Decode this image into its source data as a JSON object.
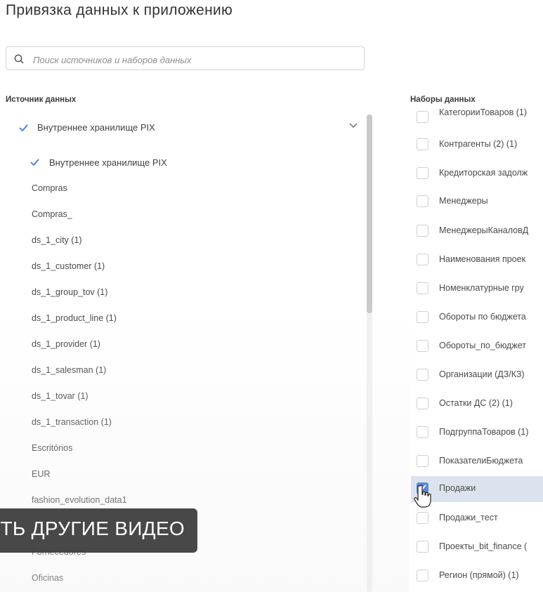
{
  "page": {
    "title": "Привязка данных к приложению"
  },
  "search": {
    "placeholder": "Поиск источников и наборов данных",
    "value": ""
  },
  "sources": {
    "label": "Источник данных",
    "parent": "Внутреннее хранилище PIX",
    "items": [
      {
        "label": "Внутреннее хранилище PIX",
        "selected": true
      },
      {
        "label": "Compras"
      },
      {
        "label": "Compras_"
      },
      {
        "label": "ds_1_city (1)"
      },
      {
        "label": "ds_1_customer (1)"
      },
      {
        "label": "ds_1_group_tov (1)"
      },
      {
        "label": "ds_1_product_line (1)"
      },
      {
        "label": "ds_1_provider (1)"
      },
      {
        "label": "ds_1_salesman (1)"
      },
      {
        "label": "ds_1_tovar (1)"
      },
      {
        "label": "ds_1_transaction (1)"
      },
      {
        "label": "Escritórios"
      },
      {
        "label": "EUR"
      },
      {
        "label": "fashion_evolution_data1"
      },
      {
        "label": ""
      },
      {
        "label": "Fornecedores"
      },
      {
        "label": "Oficinas"
      }
    ]
  },
  "datasets": {
    "label": "Наборы данных",
    "items": [
      {
        "label": "КатегорииТоваров (1)",
        "checked": false
      },
      {
        "label": "Контрагенты (2) (1)",
        "checked": false
      },
      {
        "label": "Кредиторская задолж",
        "checked": false
      },
      {
        "label": "Менеджеры",
        "checked": false
      },
      {
        "label": "МенеджерыКаналовД",
        "checked": false
      },
      {
        "label": "Наименования проек",
        "checked": false
      },
      {
        "label": "Номенклатурные гру",
        "checked": false
      },
      {
        "label": "Обороты по бюджета",
        "checked": false
      },
      {
        "label": "Обороты_по_бюджет",
        "checked": false
      },
      {
        "label": "Организации (ДЗ/КЗ)",
        "checked": false
      },
      {
        "label": "Остатки ДС (2) (1)",
        "checked": false
      },
      {
        "label": "ПодгруппаТоваров (1)",
        "checked": false
      },
      {
        "label": "ПоказателиБюджета",
        "checked": false
      },
      {
        "label": "Продажи",
        "checked": true
      },
      {
        "label": "Продажи_тест",
        "checked": false
      },
      {
        "label": "Проекты_bit_finance (",
        "checked": false
      },
      {
        "label": "Регион (прямой) (1)",
        "checked": false
      }
    ]
  },
  "overlay": {
    "text": "ТЬ ДРУГИЕ ВИДЕО"
  },
  "colors": {
    "accent": "#3b7de0",
    "checked_bg": "#5b8bd9",
    "selected_row": "#dde3ee"
  }
}
